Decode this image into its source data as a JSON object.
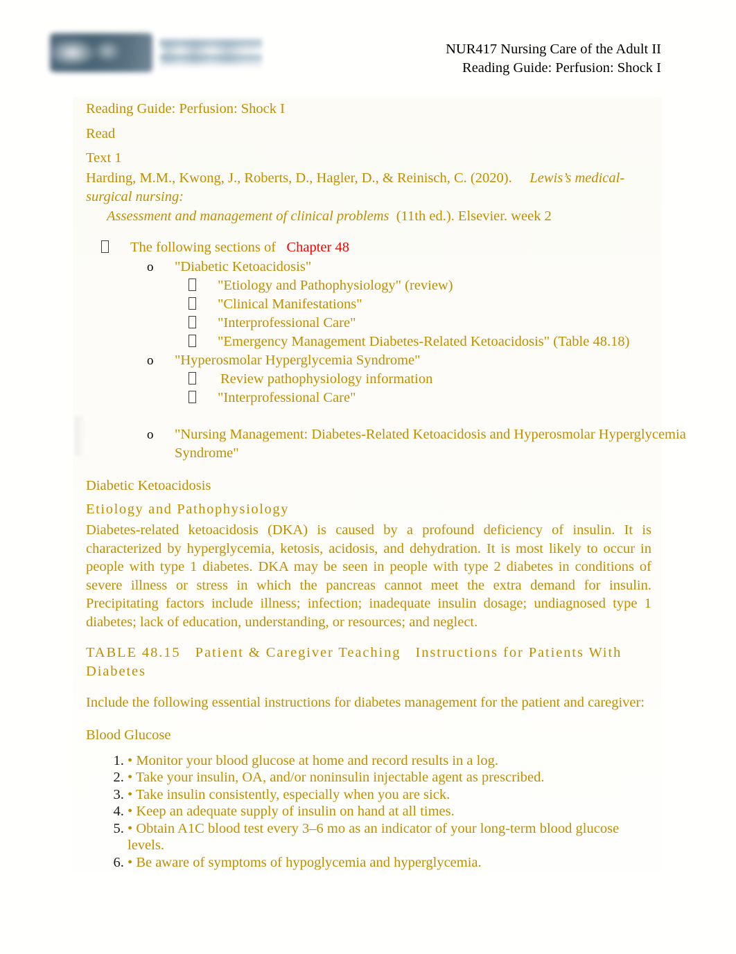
{
  "colors": {
    "body_text": "#BF8F00",
    "highlight_red": "#FF0000",
    "header_text": "#000000",
    "page_background": "#FFFFFF"
  },
  "header": {
    "course_line": "NUR417 Nursing Care of the Adult II",
    "guide_line": "Reading Guide: Perfusion: Shock I",
    "logo_alt": "CSP logo"
  },
  "body": {
    "title": "Reading Guide: Perfusion: Shock I",
    "read_label": "Read",
    "text_label": "Text 1",
    "citation_line1": "Harding, M.M., Kwong, J., Roberts, D., Hagler, D., & Reinisch, C. (2020).",
    "citation_line1_italic": "Lewis’s medical-surgical nursing:",
    "citation_line2_italic": "Assessment and management of clinical problems",
    "citation_line2_rest": "(11th ed.). Elsevier.  week 2"
  },
  "outline": {
    "lead_prefix": "The following sections of",
    "lead_chapter": "Chapter 48",
    "groups": [
      {
        "label": "\"Diabetic Ketoacidosis\"",
        "children": [
          "\"Etiology and Pathophysiology\" (review)",
          "\"Clinical Manifestations\"",
          "\"Interprofessional Care\"",
          "\"Emergency Management Diabetes-Related Ketoacidosis\" (Table 48.18)"
        ]
      },
      {
        "label": "\"Hyperosmolar Hyperglycemia Syndrome\"",
        "children": [
          "Review pathophysiology information",
          "\"Interprofessional Care\""
        ]
      },
      {
        "label": "\"Nursing Management: Diabetes-Related Ketoacidosis and Hyperosmolar Hyperglycemia Syndrome\"",
        "children": []
      }
    ]
  },
  "dka": {
    "heading": "Diabetic Ketoacidosis",
    "subheading": "Etiology and Pathophysiology",
    "paragraph": "Diabetes-related ketoacidosis (DKA)  is caused by a profound deficiency of insulin. It is characterized by hyperglycemia, ketosis, acidosis, and dehydration. It is most likely to occur in people with type 1 diabetes. DKA may be seen in people with type 2 diabetes in conditions of severe illness or stress in which the pancreas cannot meet the extra demand for insulin. Precipitating factors include illness; infection; inadequate insulin dosage; undiagnosed type 1 diabetes; lack of education, understanding, or resources; and neglect."
  },
  "table_block": {
    "table_number": "TABLE 48.15",
    "table_kind": "Patient & Caregiver Teaching",
    "table_title": "Instructions for Patients With Diabetes",
    "intro": "Include the following essential instructions for diabetes management for the patient and caregiver:",
    "subhead": "Blood Glucose",
    "bullet_char": "•",
    "items": [
      "Monitor your blood glucose at home and record results in a log.",
      "Take your insulin, OA, and/or noninsulin injectable agent as prescribed.",
      "Take insulin consistently, especially when you are sick.",
      "Keep an adequate supply of insulin on hand at all times.",
      "Obtain A1C blood test every 3–6 mo as an indicator of your long-term blood glucose levels.",
      "Be aware of symptoms of hypoglycemia and hyperglycemia."
    ]
  }
}
